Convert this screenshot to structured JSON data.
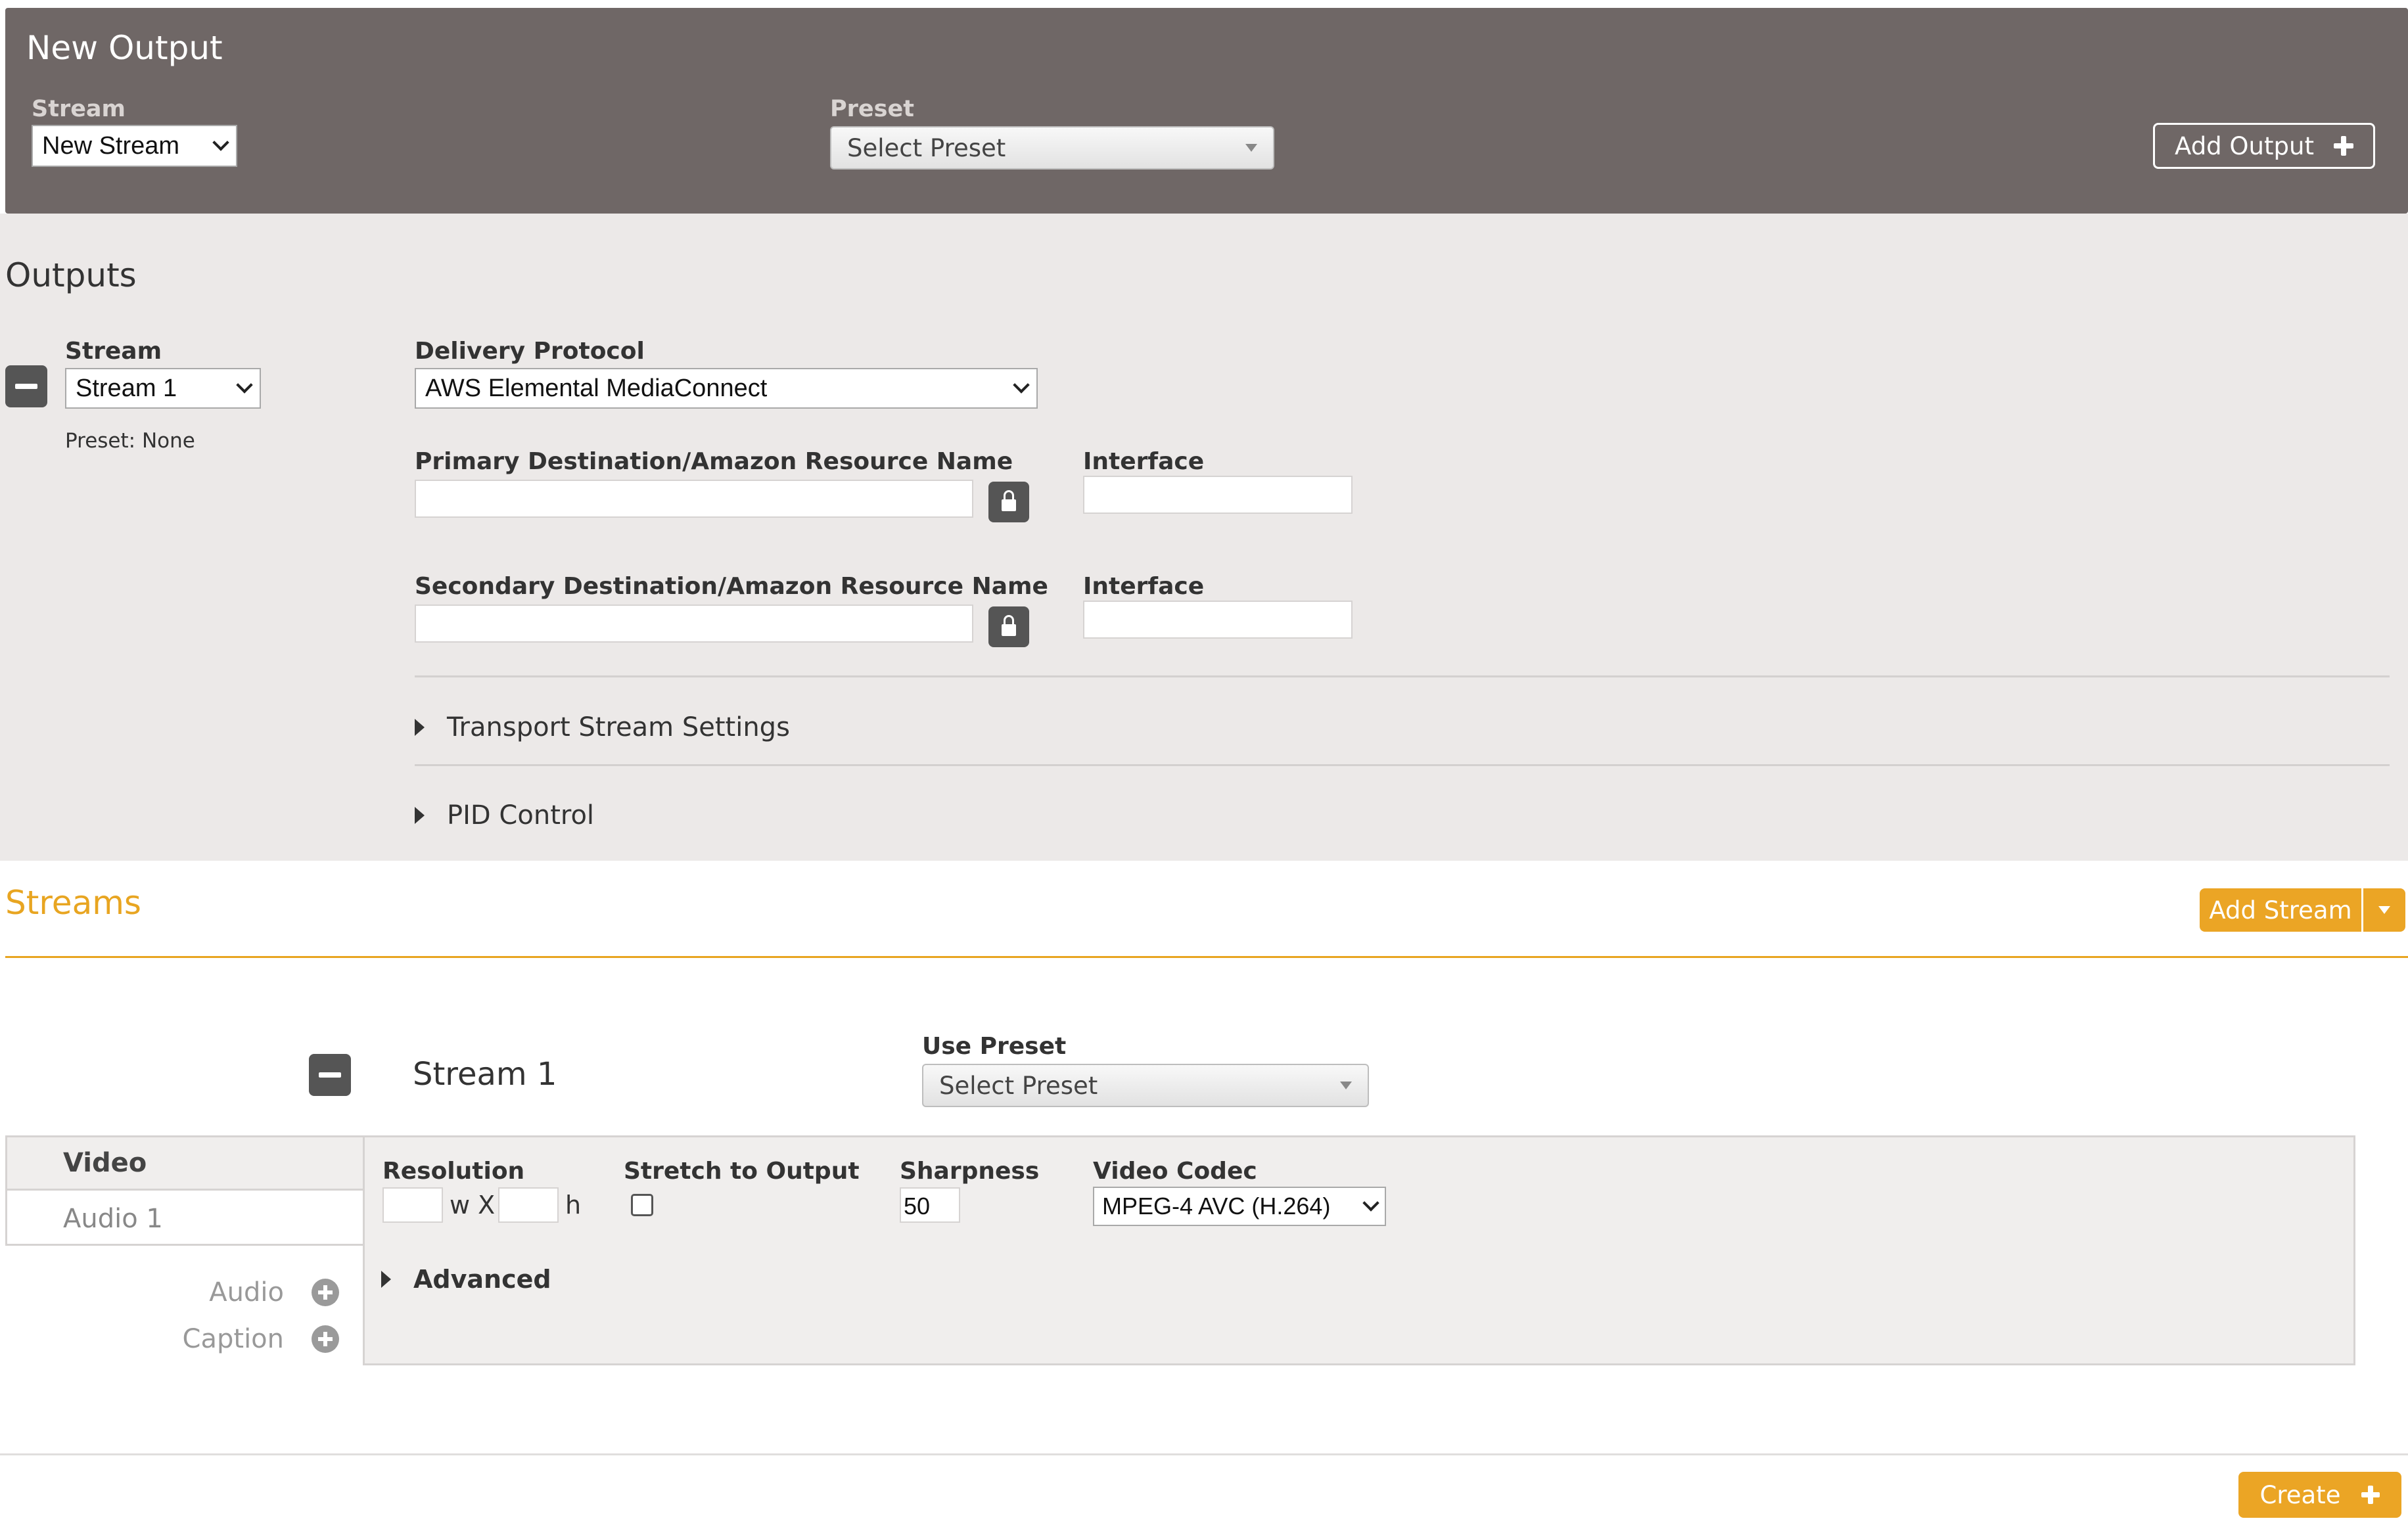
{
  "new_output": {
    "title": "New Output",
    "stream_label": "Stream",
    "stream_value": "New Stream",
    "preset_label": "Preset",
    "preset_value": "Select Preset",
    "add_output_label": "Add Output"
  },
  "outputs": {
    "title": "Outputs",
    "stream_label": "Stream",
    "stream_value": "Stream 1",
    "preset_text": "Preset: None",
    "delivery_protocol_label": "Delivery Protocol",
    "delivery_protocol_value": "AWS Elemental MediaConnect",
    "primary_destination_label": "Primary Destination/Amazon Resource Name",
    "primary_destination_value": "",
    "primary_interface_label": "Interface",
    "primary_interface_value": "",
    "secondary_destination_label": "Secondary Destination/Amazon Resource Name",
    "secondary_destination_value": "",
    "secondary_interface_label": "Interface",
    "secondary_interface_value": "",
    "transport_stream_settings_label": "Transport Stream Settings",
    "pid_control_label": "PID Control"
  },
  "streams": {
    "title": "Streams",
    "add_stream_label": "Add Stream",
    "stream_name": "Stream 1",
    "use_preset_label": "Use Preset",
    "use_preset_value": "Select Preset",
    "tabs": [
      {
        "label": "Video",
        "active": true
      },
      {
        "label": "Audio 1",
        "active": false
      }
    ],
    "add_audio_label": "Audio",
    "add_caption_label": "Caption",
    "video": {
      "resolution_label": "Resolution",
      "width_value": "",
      "height_value": "",
      "w_x_text": "w X",
      "h_text": "h",
      "stretch_label": "Stretch to Output",
      "stretch_checked": false,
      "sharpness_label": "Sharpness",
      "sharpness_value": "50",
      "codec_label": "Video Codec",
      "codec_value": "MPEG-4 AVC (H.264)",
      "advanced_label": "Advanced"
    }
  },
  "footer": {
    "create_label": "Create"
  },
  "colors": {
    "accent": "#e8a521",
    "header_bg": "#6f6766",
    "panel_bg": "#ece9e8"
  }
}
